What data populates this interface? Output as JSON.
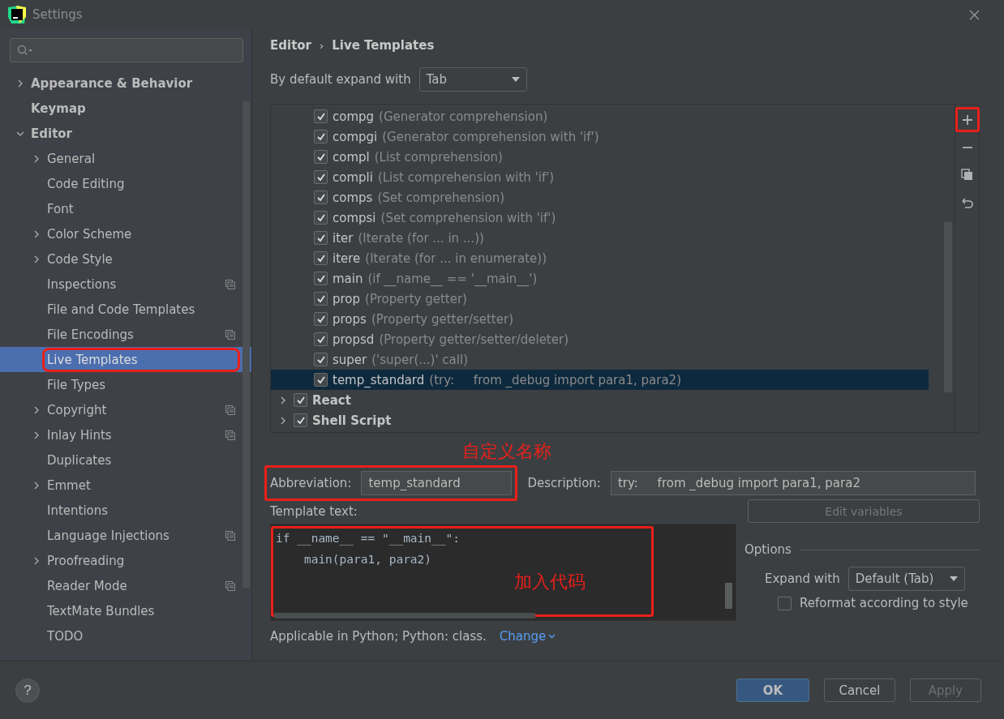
{
  "window": {
    "title": "Settings"
  },
  "sidebar": {
    "items": [
      {
        "label": "Appearance & Behavior",
        "kind": "group",
        "expanded": false,
        "selected": false,
        "highlighted": false
      },
      {
        "label": "Keymap",
        "kind": "leaf",
        "selected": false,
        "highlighted": false
      },
      {
        "label": "Editor",
        "kind": "group",
        "expanded": true,
        "selected": false,
        "highlighted": false,
        "children": [
          {
            "label": "General",
            "kind": "group",
            "expanded": false,
            "selected": false,
            "highlighted": false,
            "project": false
          },
          {
            "label": "Code Editing",
            "kind": "leaf",
            "selected": false,
            "highlighted": false,
            "project": false
          },
          {
            "label": "Font",
            "kind": "leaf",
            "selected": false,
            "highlighted": false,
            "project": false
          },
          {
            "label": "Color Scheme",
            "kind": "group",
            "expanded": false,
            "selected": false,
            "highlighted": false,
            "project": false
          },
          {
            "label": "Code Style",
            "kind": "group",
            "expanded": false,
            "selected": false,
            "highlighted": false,
            "project": false
          },
          {
            "label": "Inspections",
            "kind": "leaf",
            "selected": false,
            "highlighted": false,
            "project": true
          },
          {
            "label": "File and Code Templates",
            "kind": "leaf",
            "selected": false,
            "highlighted": false,
            "project": false
          },
          {
            "label": "File Encodings",
            "kind": "leaf",
            "selected": false,
            "highlighted": false,
            "project": true
          },
          {
            "label": "Live Templates",
            "kind": "leaf",
            "selected": true,
            "highlighted": true,
            "project": false
          },
          {
            "label": "File Types",
            "kind": "leaf",
            "selected": false,
            "highlighted": false,
            "project": false
          },
          {
            "label": "Copyright",
            "kind": "group",
            "expanded": false,
            "selected": false,
            "highlighted": false,
            "project": true
          },
          {
            "label": "Inlay Hints",
            "kind": "group",
            "expanded": false,
            "selected": false,
            "highlighted": false,
            "project": true
          },
          {
            "label": "Duplicates",
            "kind": "leaf",
            "selected": false,
            "highlighted": false,
            "project": false
          },
          {
            "label": "Emmet",
            "kind": "group",
            "expanded": false,
            "selected": false,
            "highlighted": false,
            "project": false
          },
          {
            "label": "Intentions",
            "kind": "leaf",
            "selected": false,
            "highlighted": false,
            "project": false
          },
          {
            "label": "Language Injections",
            "kind": "leaf",
            "selected": false,
            "highlighted": false,
            "project": true
          },
          {
            "label": "Proofreading",
            "kind": "group",
            "expanded": false,
            "selected": false,
            "highlighted": false,
            "project": false
          },
          {
            "label": "Reader Mode",
            "kind": "leaf",
            "selected": false,
            "highlighted": false,
            "project": true
          },
          {
            "label": "TextMate Bundles",
            "kind": "leaf",
            "selected": false,
            "highlighted": false,
            "project": false
          },
          {
            "label": "TODO",
            "kind": "leaf",
            "selected": false,
            "highlighted": false,
            "project": false
          }
        ]
      }
    ]
  },
  "breadcrumb": [
    "Editor",
    "›",
    "Live Templates"
  ],
  "help": "?",
  "expand_default": {
    "label": "By default expand with",
    "value": "Tab"
  },
  "templates": [
    {
      "abbreviation": "compg",
      "description": "(Generator comprehension)",
      "checked": true,
      "selected": false
    },
    {
      "abbreviation": "compgi",
      "description": "(Generator comprehension with 'if')",
      "checked": true,
      "selected": false
    },
    {
      "abbreviation": "compl",
      "description": "(List comprehension)",
      "checked": true,
      "selected": false
    },
    {
      "abbreviation": "compli",
      "description": "(List comprehension with 'if')",
      "checked": true,
      "selected": false
    },
    {
      "abbreviation": "comps",
      "description": "(Set comprehension)",
      "checked": true,
      "selected": false
    },
    {
      "abbreviation": "compsi",
      "description": "(Set comprehension with 'if')",
      "checked": true,
      "selected": false
    },
    {
      "abbreviation": "iter",
      "description": "(Iterate (for ... in ...))",
      "checked": true,
      "selected": false
    },
    {
      "abbreviation": "itere",
      "description": "(Iterate (for ... in enumerate))",
      "checked": true,
      "selected": false
    },
    {
      "abbreviation": "main",
      "description": "(if __name__ == '__main__')",
      "checked": true,
      "selected": false
    },
    {
      "abbreviation": "prop",
      "description": "(Property getter)",
      "checked": true,
      "selected": false
    },
    {
      "abbreviation": "props",
      "description": "(Property getter/setter)",
      "checked": true,
      "selected": false
    },
    {
      "abbreviation": "propsd",
      "description": "(Property getter/setter/deleter)",
      "checked": true,
      "selected": false
    },
    {
      "abbreviation": "super",
      "description": "('super(...)' call)",
      "checked": true,
      "selected": false
    },
    {
      "abbreviation": "temp_standard",
      "description": "(try:     from _debug import para1, para2)",
      "checked": true,
      "selected": true
    }
  ],
  "template_groups": [
    {
      "label": "React",
      "checked": true,
      "expanded": false
    },
    {
      "label": "Shell Script",
      "checked": true,
      "expanded": false
    }
  ],
  "toolbar": [
    {
      "kind": "add",
      "highlighted": true
    },
    {
      "kind": "remove",
      "highlighted": false
    },
    {
      "kind": "copy",
      "highlighted": false
    },
    {
      "kind": "restore",
      "highlighted": false
    }
  ],
  "annotations": [
    {
      "text": "自定义名称"
    },
    {
      "text": "加入代码"
    }
  ],
  "abbreviation": {
    "label": "Abbreviation:",
    "value": "temp_standard",
    "highlighted": true
  },
  "description": {
    "label": "Description:",
    "value": "try:     from _debug import para1, para2"
  },
  "template_text": {
    "label": "Template text:",
    "lines": [
      "if __name__ == \"__main__\":",
      "    main(para1, para2)"
    ],
    "highlighted": true
  },
  "edit_variables": {
    "label": "Edit variables",
    "disabled": true
  },
  "options": {
    "title": "Options",
    "expand_label": "Expand with",
    "expand_value": "Default (Tab)",
    "reformat": {
      "label": "Reformat according to style",
      "checked": false
    }
  },
  "applicable": {
    "text": "Applicable in Python; Python: class.",
    "link": "Change"
  },
  "buttons": [
    {
      "label": "OK",
      "kind": "primary",
      "disabled": false
    },
    {
      "label": "Cancel",
      "kind": "normal",
      "disabled": false
    },
    {
      "label": "Apply",
      "kind": "normal",
      "disabled": true
    }
  ]
}
